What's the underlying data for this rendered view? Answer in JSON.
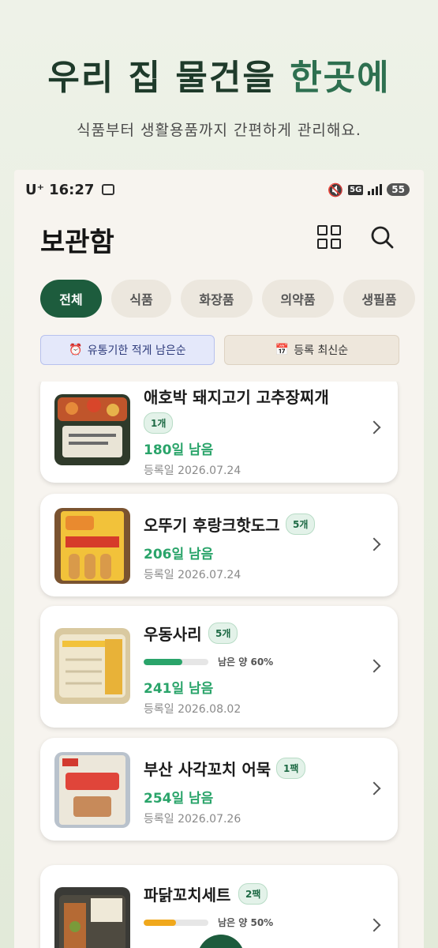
{
  "hero": {
    "title_main": "우리 집 물건을 ",
    "title_accent": "한곳에",
    "subtitle": "식품부터 생활용품까지 간편하게 관리해요."
  },
  "status": {
    "carrier": "U⁺",
    "time": "16:27",
    "network": "5G",
    "battery": "55"
  },
  "header": {
    "title": "보관함"
  },
  "chips": [
    "전체",
    "식품",
    "화장품",
    "의약품",
    "생필품"
  ],
  "sorts": [
    {
      "icon": "⏰",
      "label": "유통기한 적게 남은순"
    },
    {
      "icon": "📅",
      "label": "등록 최신순"
    }
  ],
  "items": [
    {
      "name": "애호박 돼지고기 고추장찌개",
      "qty": "1개",
      "remaining": "180일 남음",
      "registered": "등록일 2026.07.24"
    },
    {
      "name": "오뚜기 후랑크핫도그",
      "qty": "5개",
      "remaining": "206일 남음",
      "registered": "등록일 2026.07.24"
    },
    {
      "name": "우동사리",
      "qty": "5개",
      "progress_label": "남은 양 60%",
      "progress": 0.6,
      "progress_color": "#2aa46a",
      "remaining": "241일 남음",
      "registered": "등록일 2026.08.02"
    },
    {
      "name": "부산 사각꼬치 어묵",
      "qty": "1팩",
      "remaining": "254일 남음",
      "registered": "등록일 2026.07.26"
    },
    {
      "name": "파닭꼬치세트",
      "qty": "2팩",
      "progress_label": "남은 양 50%",
      "progress": 0.5,
      "progress_color": "#f0a81c"
    }
  ]
}
